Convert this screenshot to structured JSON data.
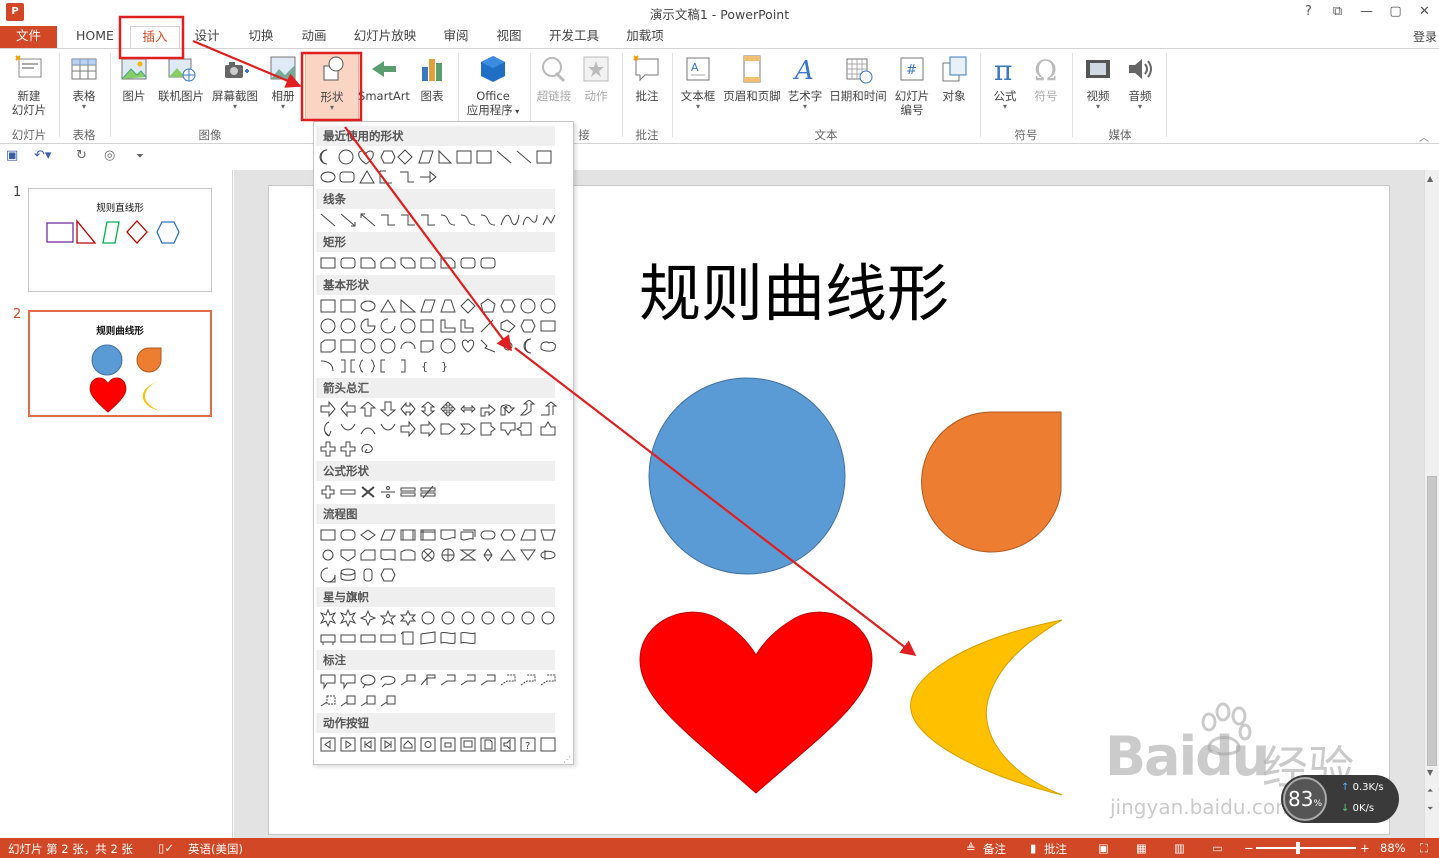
{
  "window": {
    "title": "演示文稿1 - PowerPoint",
    "help": "?",
    "controls": [
      "⧉",
      "—",
      "▢",
      "✕"
    ],
    "app_icon": "P"
  },
  "tabs": {
    "file": "文件",
    "home": "HOME",
    "insert": "插入",
    "design": "设计",
    "transitions": "切换",
    "animations": "动画",
    "slideshow": "幻灯片放映",
    "review": "审阅",
    "view": "视图",
    "developer": "开发工具",
    "addins": "加载项",
    "login": "登录"
  },
  "ribbon": {
    "new_slide": "新建\n幻灯片",
    "table": "表格",
    "picture": "图片",
    "online_picture": "联机图片",
    "screenshot": "屏幕截图",
    "album": "相册",
    "shapes": "形状",
    "smartart": "SmartArt",
    "chart": "图表",
    "office_apps_1": "Office",
    "office_apps_2": "应用程序",
    "hyperlink": "超链接",
    "action": "动作",
    "comment": "批注",
    "textbox": "文本框",
    "header_footer": "页眉和页脚",
    "wordart": "艺术字",
    "datetime": "日期和时间",
    "slide_num_1": "幻灯片",
    "slide_num_2": "编号",
    "object": "对象",
    "equation": "公式",
    "symbol": "符号",
    "video": "视频",
    "audio": "音频",
    "groups": {
      "slides": "幻灯片",
      "tables": "表格",
      "images": "图像",
      "links": "接",
      "comments": "批注",
      "text": "文本",
      "symbols": "符号",
      "media": "媒体"
    }
  },
  "dropdown": {
    "recent": "最近使用的形状",
    "lines": "线条",
    "rect": "矩形",
    "basic": "基本形状",
    "arrows": "箭头总汇",
    "equation": "公式形状",
    "flowchart": "流程图",
    "stars": "星与旗帜",
    "callouts": "标注",
    "action_buttons": "动作按钮"
  },
  "slides_pane": {
    "slide1": {
      "num": "1",
      "title": "规则直线形"
    },
    "slide2": {
      "num": "2",
      "title": "规则曲线形"
    }
  },
  "slide": {
    "title": "规则曲线形"
  },
  "status": {
    "slide_info": "幻灯片 第 2 张，共 2 张",
    "language": "英语(美国)",
    "notes": "备注",
    "comments": "批注",
    "zoom": "88%"
  },
  "overlay": {
    "percent": "83",
    "unit": "%",
    "up": "0.3K/s",
    "down": "0K/s"
  },
  "watermark": {
    "brand": "Bai",
    "brand2": "du",
    "cn": "经验",
    "url": "jingyan.baidu.com"
  },
  "colors": {
    "accent": "#d24726",
    "blue": "#5b9bd5",
    "orange": "#ed7d31",
    "red": "#ff0000",
    "yellow": "#ffc000",
    "annotation": "#e02020"
  }
}
